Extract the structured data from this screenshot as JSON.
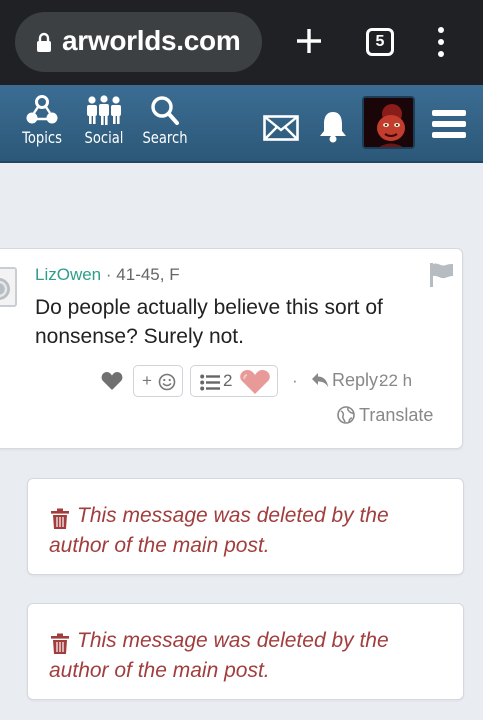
{
  "browser": {
    "url": "arworlds.com",
    "tab_count": "5",
    "icons": [
      "lock-icon",
      "plus-icon",
      "tab-switcher-icon",
      "kebab-menu-icon"
    ]
  },
  "nav": {
    "items": [
      {
        "label": "Topics",
        "icon": "topics-icon"
      },
      {
        "label": "Social",
        "icon": "social-icon"
      },
      {
        "label": "Search",
        "icon": "search-icon"
      }
    ],
    "icons": [
      "mail-icon",
      "bell-icon",
      "avatar",
      "hamburger-icon"
    ],
    "colors": {
      "bar": "#2f5f85",
      "text": "#ffffff"
    }
  },
  "comment": {
    "username": "LizOwen",
    "separator": "·",
    "user_info": "41-45, F",
    "text": "Do people actually believe this sort of nonsense? Surely not.",
    "add_reaction_label": "+",
    "list_count": "2",
    "dot": "·",
    "reply_label": "Reply",
    "reply_separator": "·",
    "time": "22 h",
    "translate_label": "Translate",
    "colors": {
      "username": "#2e9e8c",
      "muted": "#888888"
    }
  },
  "deleted_messages": [
    {
      "text": "This message was deleted by the author of the main post."
    },
    {
      "text": "This message was deleted by the author of the main post."
    }
  ],
  "colors": {
    "deleted_text": "#a23d3d",
    "page_bg": "#e9edf1"
  }
}
